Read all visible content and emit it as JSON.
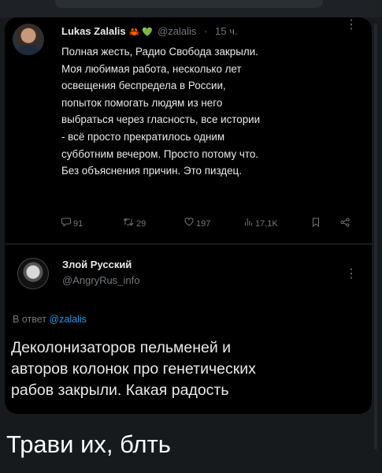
{
  "tweet": {
    "author_name": "Lukas Zalalis",
    "author_emoji": "🦀 💚",
    "author_handle": "@zalalis",
    "time": "15 ч.",
    "more": "⋮",
    "text": "Полная жесть, Радио Свобода закрыли.\nМоя любимая работа, несколько лет\nосвещения беспредела в России,\nпопыток помогать людям из него\nвыбраться через гласность, все истории\n- всё просто прекратилось одним\nсубботним вечером. Просто потому что.\nБез объяснения причин. Это пиздец.",
    "actions": {
      "replies": "91",
      "retweets": "29",
      "likes": "197",
      "views": "17,1K"
    },
    "icons": {
      "reply": "reply-icon",
      "retweet": "retweet-icon",
      "like": "heart-icon",
      "views": "views-icon",
      "bookmark": "bookmark-icon",
      "share": "share-icon"
    }
  },
  "reply": {
    "author_name": "Злой Русский",
    "author_handle": "@AngryRus_info",
    "more": "⋮",
    "reply_prefix": "В ответ",
    "reply_mention": "@zalalis",
    "text": "Деколонизаторов пельменей и\nавторов колонок про генетических\nрабов закрыли. Какая радость"
  },
  "caption": "Трави их, блть"
}
